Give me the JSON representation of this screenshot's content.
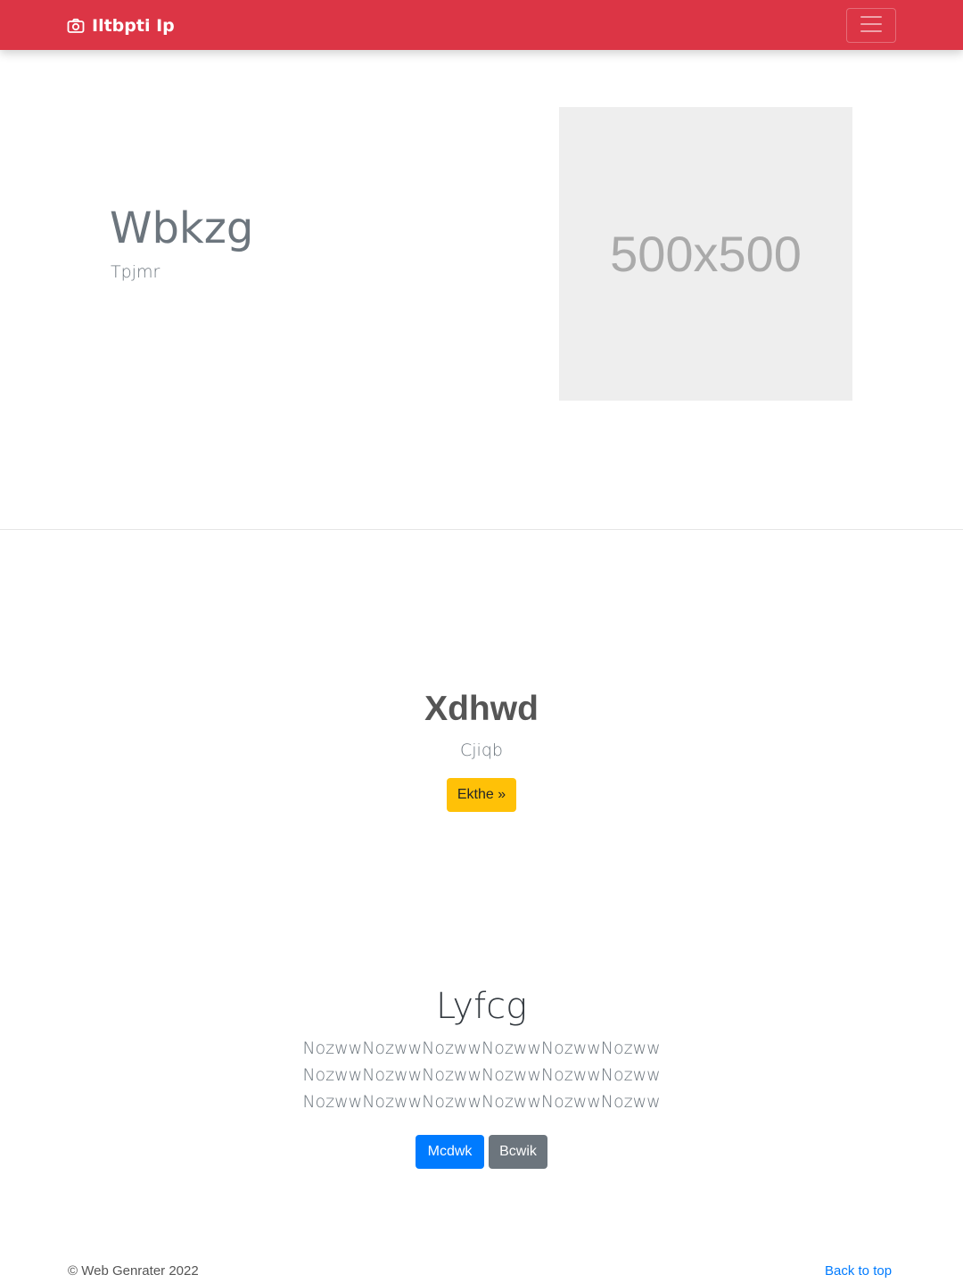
{
  "navbar": {
    "brand_label": "Iltbpti Ip",
    "brand_icon": "camera-icon",
    "toggler_icon": "hamburger-menu-icon",
    "color": "#dc3545"
  },
  "hero": {
    "title": "Wbkzg",
    "subtitle": "Tpjmr",
    "image_placeholder_text": "500x500"
  },
  "feature": {
    "title": "Xdhwd",
    "subtitle": "Cjiqb",
    "button_label": "Ekthe »",
    "button_color": "#ffc107"
  },
  "info": {
    "title": "Lyfcg",
    "paragraph_lines": [
      "NozwwNozwwNozwwNozwwNozwwNozww",
      "NozwwNozwwNozwwNozwwNozwwNozww",
      "NozwwNozwwNozwwNozwwNozwwNozww"
    ],
    "primary_button_label": "Mcdwk",
    "secondary_button_label": "Bcwik",
    "primary_color": "#007bff",
    "secondary_color": "#6c757d"
  },
  "footer": {
    "copyright": "© Web Genrater 2022",
    "back_to_top": "Back to top"
  }
}
